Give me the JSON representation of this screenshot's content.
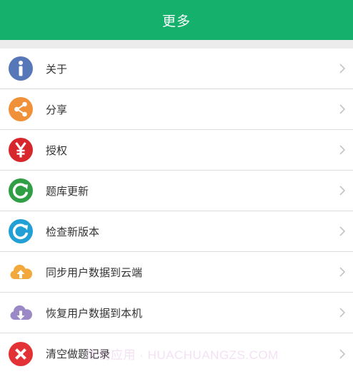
{
  "header": {
    "title": "更多"
  },
  "menu": {
    "items": [
      {
        "label": "关于",
        "icon": "info-icon",
        "color": "#5778b8"
      },
      {
        "label": "分享",
        "icon": "share-icon",
        "color": "#f0913a"
      },
      {
        "label": "授权",
        "icon": "yen-icon",
        "color": "#d7272d"
      },
      {
        "label": "题库更新",
        "icon": "refresh-icon",
        "color": "#2f9e45"
      },
      {
        "label": "检查新版本",
        "icon": "refresh-icon",
        "color": "#22a0d5"
      },
      {
        "label": "同步用户数据到云端",
        "icon": "cloud-upload-icon",
        "color": "#f3a83c"
      },
      {
        "label": "恢复用户数据到本机",
        "icon": "cloud-download-icon",
        "color": "#9a89c6"
      },
      {
        "label": "清空做题记录",
        "icon": "clear-icon",
        "color": "#e23236"
      }
    ]
  },
  "watermark": {
    "text": "华创应用 · HUACHUANGZS.COM"
  },
  "colors": {
    "header_bg": "#15b06b",
    "page_bg": "#ececec",
    "chevron": "#c4c4c4"
  }
}
